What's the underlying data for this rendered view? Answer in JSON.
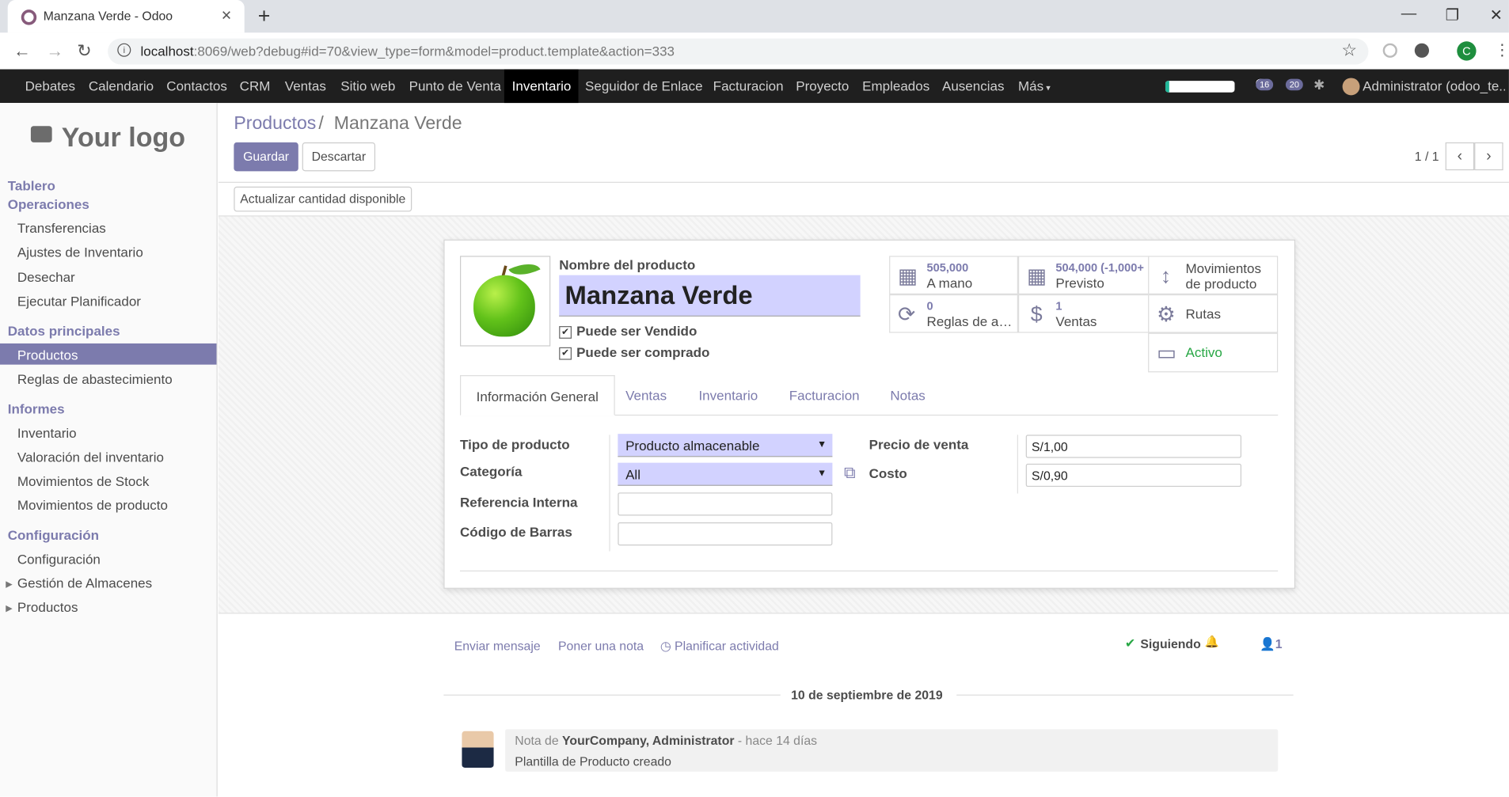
{
  "browser": {
    "tab_title": "Manzana Verde - Odoo",
    "url_host": "localhost",
    "url_rest": ":8069/web?debug#id=70&view_type=form&model=product.template&action=333",
    "profile_letter": "C"
  },
  "topnav": {
    "apps": [
      "Debates",
      "Calendario",
      "Contactos",
      "CRM",
      "Ventas",
      "Sitio web",
      "Punto de Venta",
      "Inventario",
      "Seguidor de Enlace",
      "Facturacion",
      "Proyecto",
      "Empleados",
      "Ausencias",
      "Más"
    ],
    "active_app": "Inventario",
    "progress": 0.05,
    "messages_badge": "16",
    "activity_badge": "20",
    "user": "Administrator (odoo_te..."
  },
  "sidebar": {
    "logo_text": "Your logo",
    "sections": [
      {
        "title": "Tablero",
        "items": []
      },
      {
        "title": "Operaciones",
        "items": [
          "Transferencias",
          "Ajustes de Inventario",
          "Desechar",
          "Ejecutar Planificador"
        ]
      },
      {
        "title": "Datos principales",
        "items": [
          "Productos",
          "Reglas de abastecimiento"
        ]
      },
      {
        "title": "Informes",
        "items": [
          "Inventario",
          "Valoración del inventario",
          "Movimientos de Stock",
          "Movimientos de producto"
        ]
      },
      {
        "title": "Configuración",
        "items": [
          "Configuración",
          "Gestión de Almacenes",
          "Productos"
        ]
      }
    ],
    "active_item": "Productos"
  },
  "control_panel": {
    "breadcrumb_parent": "Productos",
    "breadcrumb_sep": "/",
    "breadcrumb_current": "Manzana Verde",
    "save_label": "Guardar",
    "discard_label": "Descartar",
    "pager": "1 / 1",
    "update_qty_label": "Actualizar cantidad disponible"
  },
  "form": {
    "name_label": "Nombre del producto",
    "name_value": "Manzana Verde",
    "can_be_sold_label": "Puede ser Vendido",
    "can_be_purchased_label": "Puede ser comprado",
    "smart_buttons": {
      "on_hand_value": "505,000",
      "on_hand_label": "A mano",
      "forecast_value": "504,000 (-1,000+",
      "forecast_label": "Previsto",
      "moves_label_1": "Movimientos",
      "moves_label_2": "de producto",
      "rules_value": "0",
      "rules_label": "Reglas de abastecimiento",
      "sales_value": "1",
      "sales_label": "Ventas",
      "routes_label": "Rutas",
      "active_label": "Activo"
    },
    "tabs": [
      "Información General",
      "Ventas",
      "Inventario",
      "Facturacion",
      "Notas"
    ],
    "active_tab": "Información General",
    "fields": {
      "type_label": "Tipo de producto",
      "type_value": "Producto almacenable",
      "category_label": "Categoría",
      "category_value": "All",
      "internal_ref_label": "Referencia Interna",
      "internal_ref_value": "",
      "barcode_label": "Código de Barras",
      "barcode_value": "",
      "sale_price_label": "Precio de venta",
      "sale_price_value": "S/1,00",
      "cost_label": "Costo",
      "cost_value": "S/0,90"
    }
  },
  "chatter": {
    "send_message": "Enviar mensaje",
    "log_note": "Poner una nota",
    "schedule_activity": "Planificar actividad",
    "following": "Siguiendo",
    "followers_count": "1",
    "date_separator": "10 de septiembre de 2019",
    "message": {
      "prefix": "Nota de",
      "author": "YourCompany, Administrator",
      "time": "- hace 14 días",
      "body": "Plantilla de Producto creado"
    }
  }
}
